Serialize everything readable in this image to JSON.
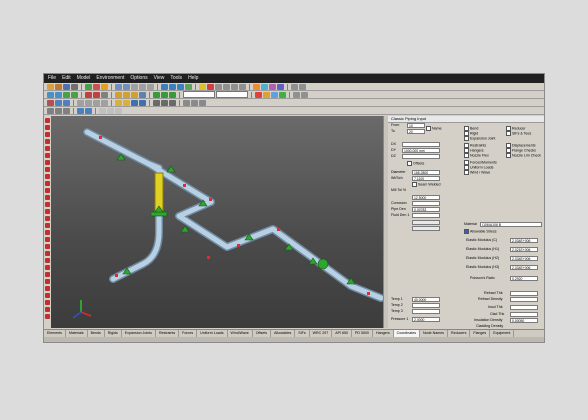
{
  "menu": [
    "File",
    "Edit",
    "Model",
    "Environment",
    "Options",
    "View",
    "Tools",
    "Help"
  ],
  "panel": {
    "title": "Classic Piping Input",
    "from_label": "From",
    "from_value": "10",
    "to_label": "To",
    "to_value": "20",
    "name_label": "Name",
    "dx_label": "DX",
    "dy_label": "DY",
    "dy_value": "1000.000 mm",
    "dz_label": "DZ",
    "offsets_label": "Offsets",
    "diameter_label": "Diameter",
    "diameter_value": "168.2800",
    "wt_label": "Wt/Sch",
    "wt_value": "7.1100",
    "seam_label": "Seam Welded",
    "mill_tol_label": "Mill Tol %",
    "mill_tol_value": "12.5000",
    "corrosion_label": "Corrosion",
    "pipe_den_label": "Pipe Den",
    "pipe_den_value": "0.00783",
    "fluid_den_label": "Fluid Den 1",
    "temp1_label": "Temp 1",
    "temp1_value": "40.0000",
    "temp2_label": "Temp 2",
    "temp3_label": "Temp 3",
    "pressure1_label": "Pressure 1",
    "pressure1_value": "2.0000",
    "checks_left": [
      "Bend",
      "Rigid",
      "Expansion Joint",
      "Restraints",
      "Hangers",
      "Nozzle Flex",
      "Forces/Moments",
      "Uniform Loads",
      "Wind / Wave"
    ],
    "checks_right": [
      "Reducer",
      "SIFs & Tees",
      "Displacements",
      "Flange Checks",
      "Nozzle Lim Check"
    ],
    "material_label": "Material",
    "material_value": "(106)A106 B",
    "allowable_label": "Allowable Stress",
    "elastic": [
      {
        "label": "Elastic Modulus (C)",
        "value": "2.034E+006"
      },
      {
        "label": "Elastic Modulus (H1)",
        "value": "2.021E+006"
      },
      {
        "label": "Elastic Modulus (H2)",
        "value": "2.034E+006"
      },
      {
        "label": "Elastic Modulus (H3)",
        "value": "2.034E+006"
      }
    ],
    "poisson_label": "Poisson's Ratio",
    "poisson_value": "0.2920",
    "refract_thk_label": "Refract Thk",
    "refract_den_label": "Refract Density",
    "insul_thk_label": "Insul Thk",
    "clad_thk_label": "Clad Thk",
    "insul_den_label": "Insulation Density",
    "insul_den_value": "0.00050",
    "clad_den_label": "Cladding Density"
  },
  "tabs": [
    "Elements",
    "Materials",
    "Bends",
    "Rigids",
    "Expansion Joints",
    "Restraints",
    "Forces",
    "Uniform Loads",
    "Wind/Wave",
    "Offsets",
    "Allowables",
    "SIFs",
    "WRC 297",
    "API 650",
    "PD 5500",
    "Hangers",
    "Coordinates",
    "Node Names",
    "Reducers",
    "Flanges",
    "Equipment"
  ],
  "active_tab": "Coordinates",
  "colors": {
    "pipe": "#a8c4dc",
    "restraint": "#2ea52e",
    "rigid": "#e0d020",
    "node": "#d83030"
  }
}
